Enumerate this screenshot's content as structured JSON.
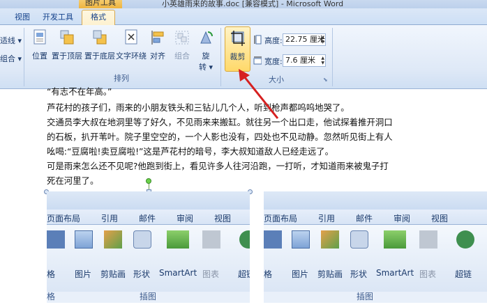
{
  "window": {
    "context_tab": "图片工具",
    "title": "小英雄雨来的故事.doc [兼容模式] - Microsoft Word"
  },
  "tabs": {
    "view": "视图",
    "developer": "开发工具",
    "format": "格式"
  },
  "ribbon": {
    "left_partial": {
      "item1": "适线 ▾",
      "item2": "组合 ▾"
    },
    "arrange": {
      "label": "排列",
      "position": "位置",
      "bring_front": "置于顶层",
      "send_back": "置于底层",
      "text_wrap": "文字环绕",
      "align": "对齐",
      "group": "组合",
      "rotate": "旋",
      "rotate2": "转 ▾"
    },
    "size": {
      "label": "大小",
      "crop": "裁剪",
      "height_label": "高度:",
      "height_value": "22.75 厘米",
      "width_label": "宽度:",
      "width_value": "7.6 厘米"
    }
  },
  "document": {
    "lines": [
      "“有志不在年高。”",
      "芦花村的孩子们，雨来的小朋友铁头和三钻儿几个人，听到枪声都呜呜地哭了。",
      "交通员李大叔在地洞里等了好久，不见雨来来搬缸。就往另一个出口走，他试探着推开洞口",
      "的石板，扒开苇叶。院子里空空的，一个人影也没有，四处也不见动静。忽然听见街上有人",
      "吆喝:“豆腐啦!卖豆腐啦!”这是芦花村的暗号，李大叔知道敌人已经走远了。",
      "可是雨来怎么还不见呢?他跑到街上，看见许多人往河沿跑，一打听，才知道雨来被鬼子打",
      "死在河里了。"
    ]
  },
  "picture": {
    "tabs": [
      "页面布局",
      "引用",
      "邮件",
      "审阅",
      "视图"
    ],
    "items": [
      "格",
      "图片",
      "剪贴画",
      "形状",
      "SmartArt",
      "图表",
      "超链"
    ],
    "group_label": "插图",
    "left_label": "格"
  },
  "colors": {
    "accent": "#ffd96a",
    "arrow": "#d62020",
    "ribbon_text": "#1b3a6b"
  }
}
